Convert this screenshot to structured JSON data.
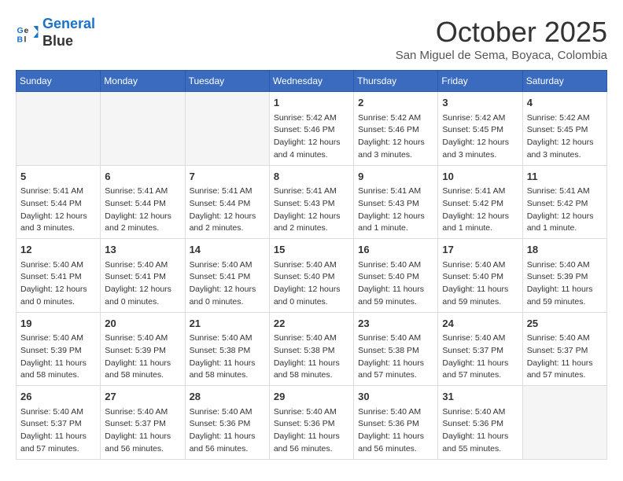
{
  "header": {
    "logo_line1": "General",
    "logo_line2": "Blue",
    "month": "October 2025",
    "location": "San Miguel de Sema, Boyaca, Colombia"
  },
  "weekdays": [
    "Sunday",
    "Monday",
    "Tuesday",
    "Wednesday",
    "Thursday",
    "Friday",
    "Saturday"
  ],
  "weeks": [
    [
      {
        "day": "",
        "info": ""
      },
      {
        "day": "",
        "info": ""
      },
      {
        "day": "",
        "info": ""
      },
      {
        "day": "1",
        "info": "Sunrise: 5:42 AM\nSunset: 5:46 PM\nDaylight: 12 hours\nand 4 minutes."
      },
      {
        "day": "2",
        "info": "Sunrise: 5:42 AM\nSunset: 5:46 PM\nDaylight: 12 hours\nand 3 minutes."
      },
      {
        "day": "3",
        "info": "Sunrise: 5:42 AM\nSunset: 5:45 PM\nDaylight: 12 hours\nand 3 minutes."
      },
      {
        "day": "4",
        "info": "Sunrise: 5:42 AM\nSunset: 5:45 PM\nDaylight: 12 hours\nand 3 minutes."
      }
    ],
    [
      {
        "day": "5",
        "info": "Sunrise: 5:41 AM\nSunset: 5:44 PM\nDaylight: 12 hours\nand 3 minutes."
      },
      {
        "day": "6",
        "info": "Sunrise: 5:41 AM\nSunset: 5:44 PM\nDaylight: 12 hours\nand 2 minutes."
      },
      {
        "day": "7",
        "info": "Sunrise: 5:41 AM\nSunset: 5:44 PM\nDaylight: 12 hours\nand 2 minutes."
      },
      {
        "day": "8",
        "info": "Sunrise: 5:41 AM\nSunset: 5:43 PM\nDaylight: 12 hours\nand 2 minutes."
      },
      {
        "day": "9",
        "info": "Sunrise: 5:41 AM\nSunset: 5:43 PM\nDaylight: 12 hours\nand 1 minute."
      },
      {
        "day": "10",
        "info": "Sunrise: 5:41 AM\nSunset: 5:42 PM\nDaylight: 12 hours\nand 1 minute."
      },
      {
        "day": "11",
        "info": "Sunrise: 5:41 AM\nSunset: 5:42 PM\nDaylight: 12 hours\nand 1 minute."
      }
    ],
    [
      {
        "day": "12",
        "info": "Sunrise: 5:40 AM\nSunset: 5:41 PM\nDaylight: 12 hours\nand 0 minutes."
      },
      {
        "day": "13",
        "info": "Sunrise: 5:40 AM\nSunset: 5:41 PM\nDaylight: 12 hours\nand 0 minutes."
      },
      {
        "day": "14",
        "info": "Sunrise: 5:40 AM\nSunset: 5:41 PM\nDaylight: 12 hours\nand 0 minutes."
      },
      {
        "day": "15",
        "info": "Sunrise: 5:40 AM\nSunset: 5:40 PM\nDaylight: 12 hours\nand 0 minutes."
      },
      {
        "day": "16",
        "info": "Sunrise: 5:40 AM\nSunset: 5:40 PM\nDaylight: 11 hours\nand 59 minutes."
      },
      {
        "day": "17",
        "info": "Sunrise: 5:40 AM\nSunset: 5:40 PM\nDaylight: 11 hours\nand 59 minutes."
      },
      {
        "day": "18",
        "info": "Sunrise: 5:40 AM\nSunset: 5:39 PM\nDaylight: 11 hours\nand 59 minutes."
      }
    ],
    [
      {
        "day": "19",
        "info": "Sunrise: 5:40 AM\nSunset: 5:39 PM\nDaylight: 11 hours\nand 58 minutes."
      },
      {
        "day": "20",
        "info": "Sunrise: 5:40 AM\nSunset: 5:39 PM\nDaylight: 11 hours\nand 58 minutes."
      },
      {
        "day": "21",
        "info": "Sunrise: 5:40 AM\nSunset: 5:38 PM\nDaylight: 11 hours\nand 58 minutes."
      },
      {
        "day": "22",
        "info": "Sunrise: 5:40 AM\nSunset: 5:38 PM\nDaylight: 11 hours\nand 58 minutes."
      },
      {
        "day": "23",
        "info": "Sunrise: 5:40 AM\nSunset: 5:38 PM\nDaylight: 11 hours\nand 57 minutes."
      },
      {
        "day": "24",
        "info": "Sunrise: 5:40 AM\nSunset: 5:37 PM\nDaylight: 11 hours\nand 57 minutes."
      },
      {
        "day": "25",
        "info": "Sunrise: 5:40 AM\nSunset: 5:37 PM\nDaylight: 11 hours\nand 57 minutes."
      }
    ],
    [
      {
        "day": "26",
        "info": "Sunrise: 5:40 AM\nSunset: 5:37 PM\nDaylight: 11 hours\nand 57 minutes."
      },
      {
        "day": "27",
        "info": "Sunrise: 5:40 AM\nSunset: 5:37 PM\nDaylight: 11 hours\nand 56 minutes."
      },
      {
        "day": "28",
        "info": "Sunrise: 5:40 AM\nSunset: 5:36 PM\nDaylight: 11 hours\nand 56 minutes."
      },
      {
        "day": "29",
        "info": "Sunrise: 5:40 AM\nSunset: 5:36 PM\nDaylight: 11 hours\nand 56 minutes."
      },
      {
        "day": "30",
        "info": "Sunrise: 5:40 AM\nSunset: 5:36 PM\nDaylight: 11 hours\nand 56 minutes."
      },
      {
        "day": "31",
        "info": "Sunrise: 5:40 AM\nSunset: 5:36 PM\nDaylight: 11 hours\nand 55 minutes."
      },
      {
        "day": "",
        "info": ""
      }
    ]
  ]
}
